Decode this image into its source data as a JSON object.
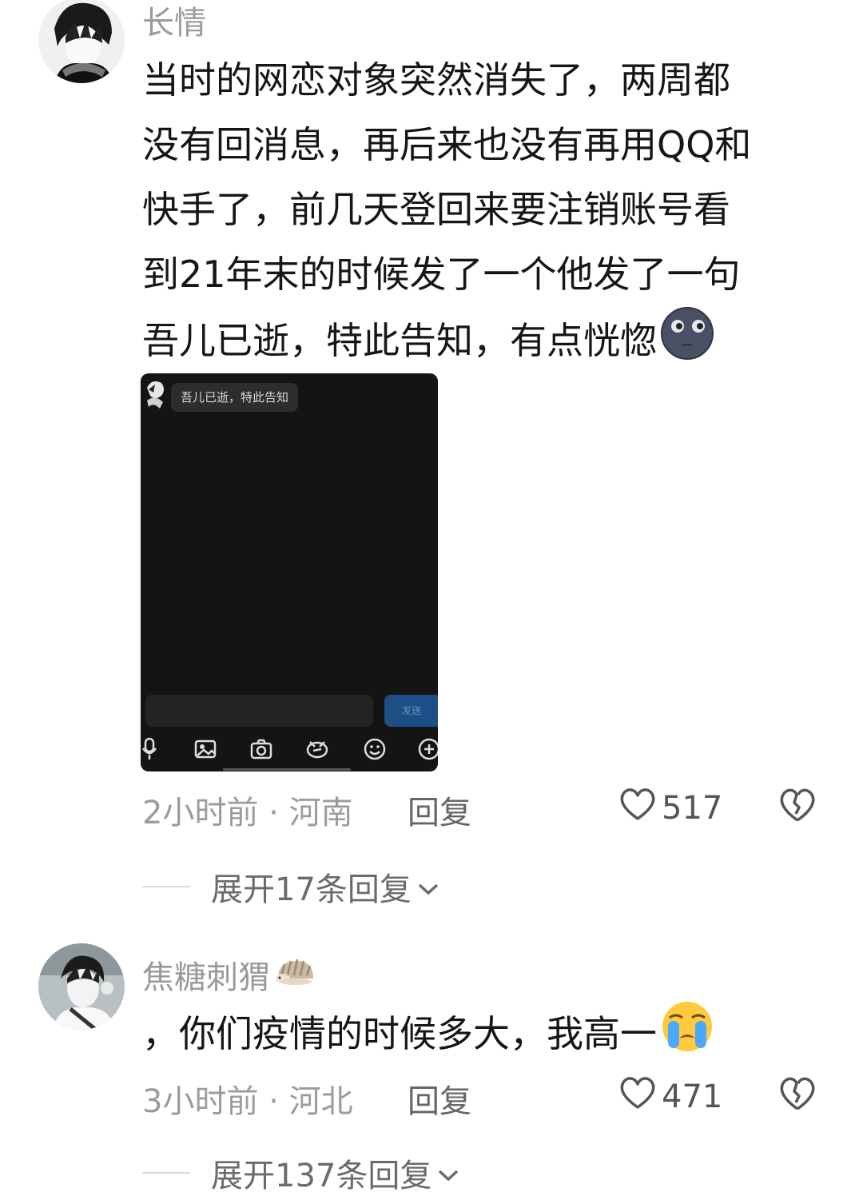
{
  "comments": [
    {
      "username": "长情",
      "text_lines": [
        "当时的网恋对象突然消失了，两周都",
        "没有回消息，再后来也没有再用QQ和",
        "快手了，前几天登回来要注销账号看",
        "到21年末的时候发了一个他发了一句",
        "吾儿已逝，特此告知，有点恍惚"
      ],
      "emoji": "new-moon-face",
      "screenshot": {
        "message": "吾儿已逝，特此告知",
        "send_label": "发送"
      },
      "meta": "2小时前 · 河南",
      "reply_label": "回复",
      "likes": "517",
      "expand_label": "展开17条回复"
    },
    {
      "username": "焦糖刺猬",
      "username_emoji": "hedgehog",
      "text": "，你们疫情的时候多大，我高一",
      "emoji": "loudly-crying-face",
      "meta": "3小时前 · 河北",
      "reply_label": "回复",
      "likes": "471",
      "expand_label": "展开137条回复"
    }
  ],
  "colors": {
    "username": "#9a9a9a",
    "body": "#161616",
    "meta": "#9c9c9c",
    "screenshot_bg": "#141414",
    "send_button": "#1d4f86"
  }
}
